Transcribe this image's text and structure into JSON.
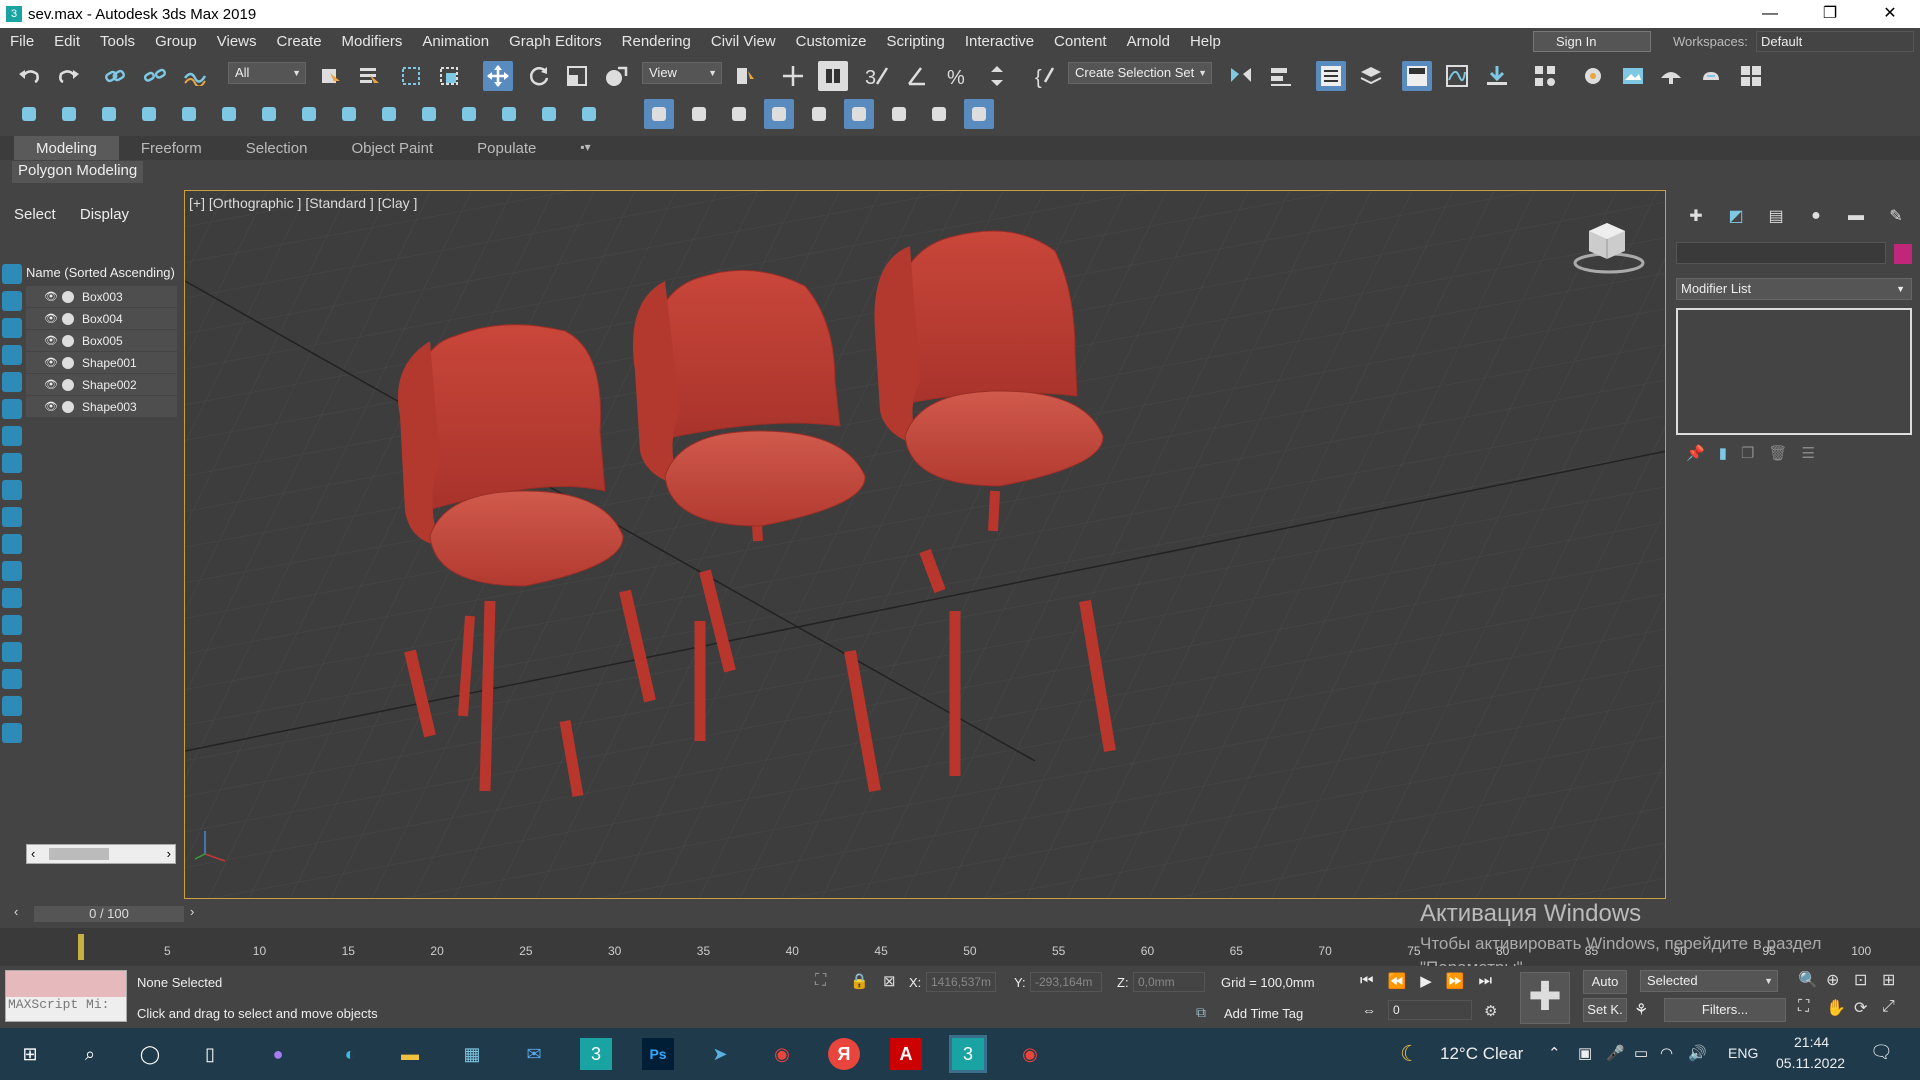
{
  "window": {
    "title": "sev.max - Autodesk 3ds Max 2019",
    "app_icon": "3ds-max-icon",
    "min": "—",
    "max": "❐",
    "close": "✕"
  },
  "menu": [
    "File",
    "Edit",
    "Tools",
    "Group",
    "Views",
    "Create",
    "Modifiers",
    "Animation",
    "Graph Editors",
    "Rendering",
    "Civil View",
    "Customize",
    "Scripting",
    "Interactive",
    "Content",
    "Arnold",
    "Help"
  ],
  "signin": "Sign In",
  "workspaces": {
    "label": "Workspaces:",
    "value": "Default"
  },
  "toolbar": {
    "filter": "All",
    "refcoord": "View",
    "selection_set": "Create Selection Set"
  },
  "ribbon": {
    "tabs": [
      "Modeling",
      "Freeform",
      "Selection",
      "Object Paint",
      "Populate"
    ],
    "active": "Modeling",
    "subtab": "Polygon Modeling"
  },
  "scene_explorer": {
    "tabs": [
      "Select",
      "Display"
    ],
    "header": "Name (Sorted Ascending)",
    "objects": [
      "Box003",
      "Box004",
      "Box005",
      "Shape001",
      "Shape002",
      "Shape003"
    ]
  },
  "viewport": {
    "label": "[+] [Orthographic ] [Standard ] [Clay ]",
    "viewcube": "FRONT"
  },
  "command_panel": {
    "modifier_list": "Modifier List",
    "accent": "#c0267a"
  },
  "time": {
    "slider": "0 / 100",
    "ticks": [
      "5",
      "10",
      "15",
      "20",
      "25",
      "30",
      "35",
      "40",
      "45",
      "50",
      "55",
      "60",
      "65",
      "70",
      "75",
      "80",
      "85",
      "90",
      "95",
      "100"
    ]
  },
  "activation": {
    "title": "Активация Windows",
    "text": "Чтобы активировать Windows, перейдите в раздел",
    "text2": "\"Параметры\"."
  },
  "status": {
    "maxscript": "MAXScript Mi:",
    "selection": "None Selected",
    "prompt": "Click and drag to select and move objects",
    "x_label": "X:",
    "x": "1416,537m",
    "y_label": "Y:",
    "y": "-293,164m",
    "z_label": "Z:",
    "z": "0,0mm",
    "grid": "Grid = 100,0mm",
    "add_time_tag": "Add Time Tag",
    "auto": "Auto",
    "selected": "Selected",
    "setk": "Set K.",
    "filters": "Filters...",
    "frame": "0"
  },
  "taskbar": {
    "weather": "12°C  Clear",
    "lang": "ENG",
    "time": "21:44",
    "date": "05.11.2022"
  }
}
